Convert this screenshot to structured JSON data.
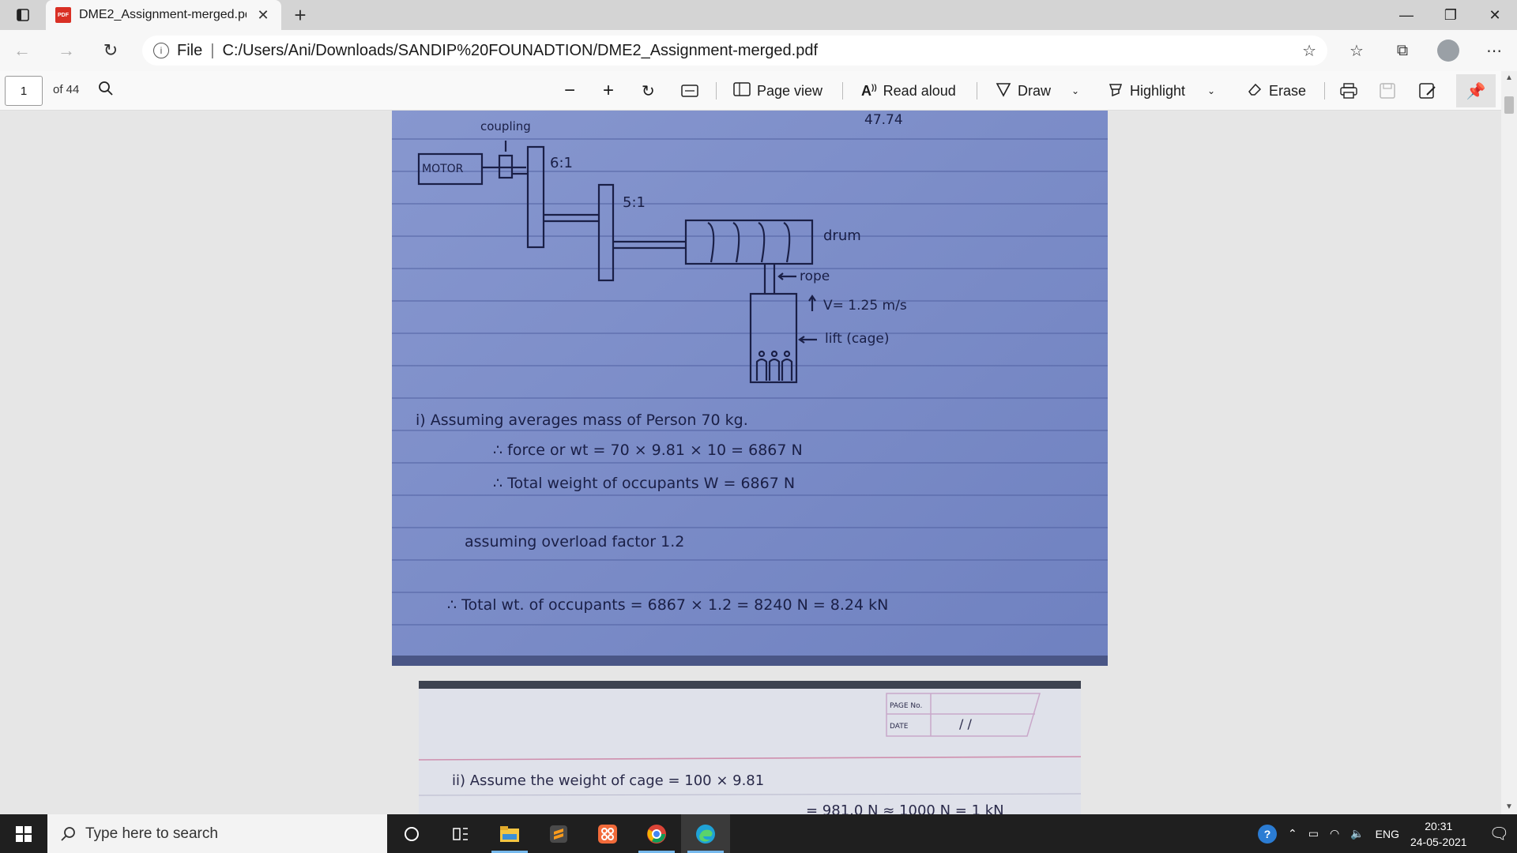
{
  "browser": {
    "tab_title": "DME2_Assignment-merged.pdf",
    "pdf_badge": "PDF",
    "address_scheme": "File",
    "address_url": "C:/Users/Ani/Downloads/SANDIP%20FOUNADTION/DME2_Assignment-merged.pdf"
  },
  "pdf_toolbar": {
    "page_number": "1",
    "page_total": "of 44",
    "page_view": "Page view",
    "read_aloud": "Read aloud",
    "draw": "Draw",
    "highlight": "Highlight",
    "erase": "Erase"
  },
  "page1_notes": {
    "top_number": "47.74",
    "coupling": "coupling",
    "motor": "MOTOR",
    "ratio1": "6:1",
    "ratio2": "5:1",
    "drum": "drum",
    "rope": "rope",
    "velocity": "V= 1.25 m/s",
    "lift": "lift (cage)",
    "line1": "i) Assuming averages mass of Person 70 kg.",
    "line2": "∴ force or wt = 70 × 9.81 × 10 = 6867 N",
    "line3": "∴ Total weight of occupants W = 6867 N",
    "line4": "assuming overload factor 1.2",
    "line5": "∴ Total wt. of occupants = 6867 × 1.2 = 8240 N = 8.24 kN"
  },
  "page2_notes": {
    "page_no_label": "PAGE No.",
    "date_label": "DATE",
    "date_value": "/ /",
    "line1": "ii) Assume the weight of cage = 100 × 9.81",
    "line2": "= 981.0 N ≈ 1000 N = 1 kN"
  },
  "taskbar": {
    "search_placeholder": "Type here to search",
    "language": "ENG",
    "time": "20:31",
    "date": "24-05-2021"
  },
  "colors": {
    "page_blue": "#7d8fc9",
    "ink": "#1a1f46",
    "accent": "#0078d4"
  }
}
